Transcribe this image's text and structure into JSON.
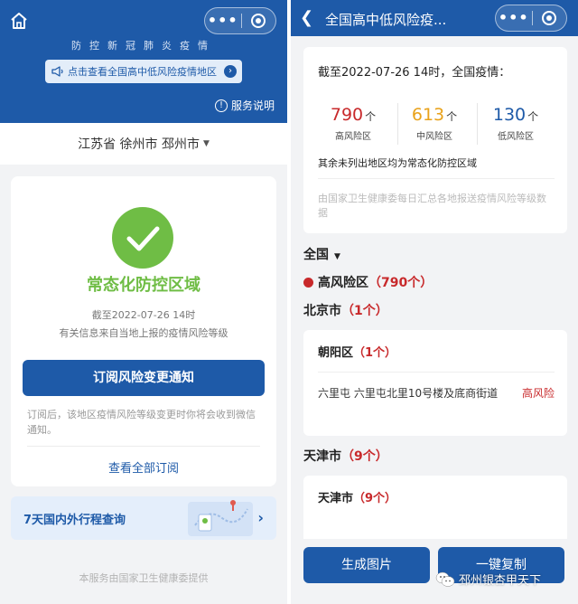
{
  "left": {
    "header": {
      "title": "防控新冠肺炎疫情",
      "notice_button": "点击查看全国高中低风险疫情地区",
      "service_info": "服务说明",
      "capsule_more": "•••"
    },
    "location": "江苏省 徐州市 邳州市",
    "status": {
      "zone_title": "常态化防控区域",
      "as_of": "截至2022-07-26 14时",
      "source_note": "有关信息来自当地上报的疫情风险等级",
      "subscribe_button": "订阅风险变更通知",
      "subscribe_hint": "订阅后，该地区疫情风险等级变更时你将会收到微信通知。",
      "view_all": "查看全部订阅"
    },
    "travel": {
      "label": "7天国内外行程查询"
    },
    "footer": "本服务由国家卫生健康委提供"
  },
  "right": {
    "header": {
      "title": "全国高中低风险疫...",
      "capsule_more": "•••"
    },
    "summary": {
      "heading": "截至2022-07-26 14时，全国疫情：",
      "stats": [
        {
          "value": "790",
          "unit": "个",
          "label": "高风险区",
          "color": "#c8292b"
        },
        {
          "value": "613",
          "unit": "个",
          "label": "中风险区",
          "color": "#e9a21a"
        },
        {
          "value": "130",
          "unit": "个",
          "label": "低风险区",
          "color": "#1e5aa8"
        }
      ],
      "others_note": "其余未列出地区均为常态化防控区域",
      "source": "由国家卫生健康委每日汇总各地报送疫情风险等级数据"
    },
    "scope": "全国",
    "high_risk": {
      "label": "高风险区",
      "count": "（790个）"
    },
    "cities": [
      {
        "name": "北京市",
        "count": "（1个）",
        "district": {
          "name": "朝阳区",
          "count": "（1个）",
          "address": "六里屯 六里屯北里10号楼及底商街道",
          "risk": "高风险"
        }
      },
      {
        "name": "天津市",
        "count": "（9个）",
        "district": {
          "name": "天津市",
          "count": "（9个）"
        }
      }
    ],
    "buttons": {
      "generate": "生成图片",
      "copy": "一键复制"
    },
    "watermark": "邳州银杏甲天下"
  },
  "colors": {
    "brand_blue": "#1e5aa8",
    "green": "#6fbd45",
    "red": "#c8292b",
    "amber": "#e9a21a",
    "background": "#f2f3f5"
  }
}
